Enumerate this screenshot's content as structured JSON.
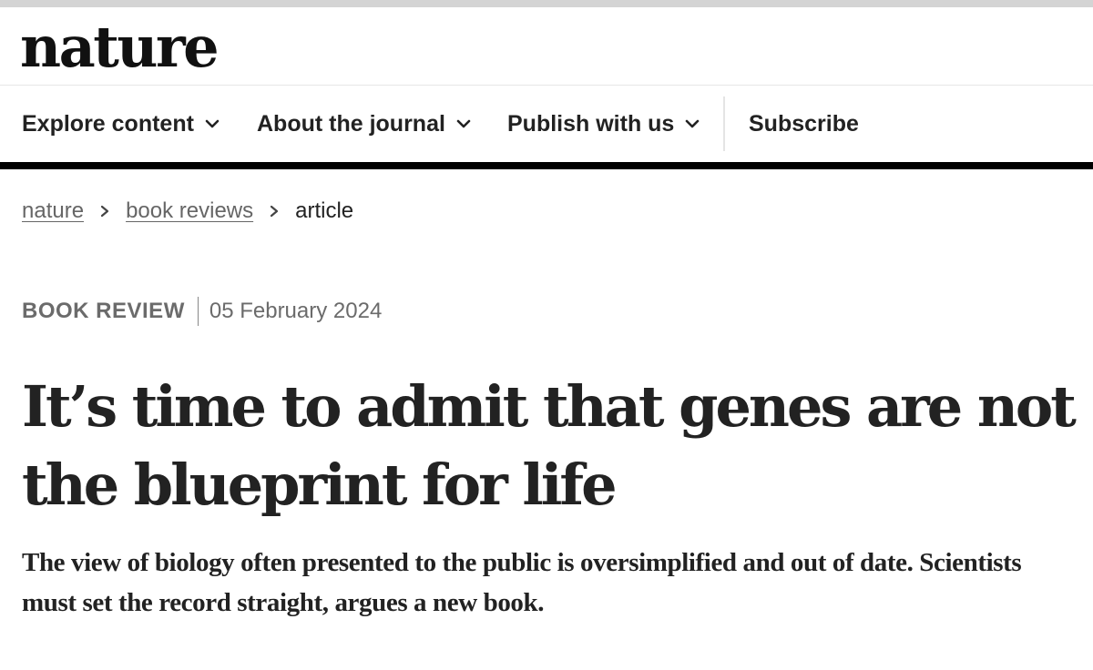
{
  "site": {
    "logo_text": "nature"
  },
  "nav": {
    "items": [
      {
        "label": "Explore content",
        "has_dropdown": true,
        "icon": "chevron-down-icon"
      },
      {
        "label": "About the journal",
        "has_dropdown": true,
        "icon": "chevron-down-icon"
      },
      {
        "label": "Publish with us",
        "has_dropdown": true,
        "icon": "chevron-down-icon"
      },
      {
        "label": "Subscribe",
        "has_dropdown": false
      }
    ]
  },
  "breadcrumb": {
    "items": [
      {
        "label": "nature",
        "link": true
      },
      {
        "label": "book reviews",
        "link": true
      },
      {
        "label": "article",
        "link": false
      }
    ],
    "separator_icon": "chevron-right-icon"
  },
  "article": {
    "type": "BOOK REVIEW",
    "date": "05 February 2024",
    "title": "It’s time to admit that genes are not the blueprint for life",
    "standfirst": "The view of biology often presented to the public is oversimplified and out of date. Scientists must set the record straight, argues a new book."
  },
  "colors": {
    "text": "#222222",
    "muted": "#6b6b6b",
    "rule_thick": "#000000",
    "rule_top": "#d4d4d4"
  }
}
